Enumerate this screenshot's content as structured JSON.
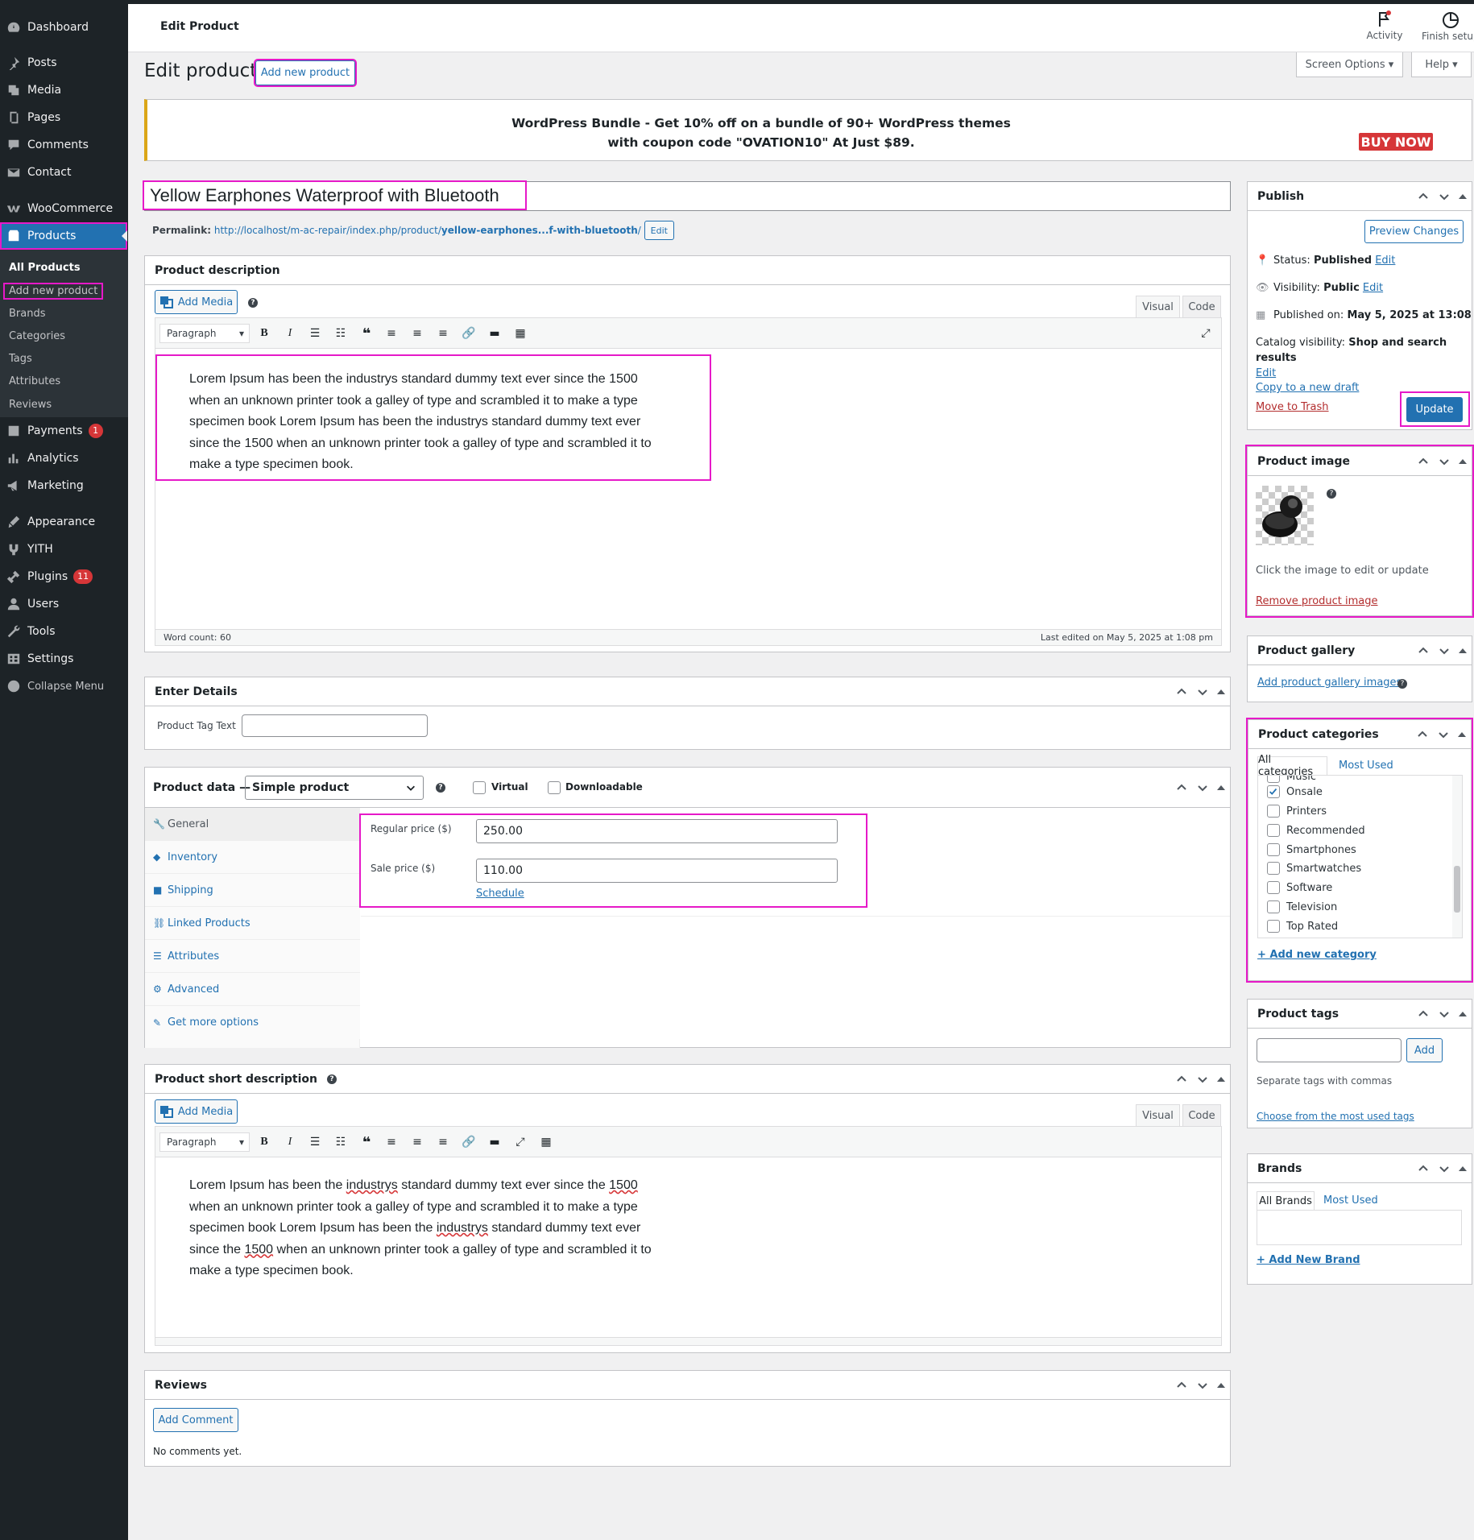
{
  "sidebar": {
    "items": [
      {
        "label": "Dashboard",
        "icon": "dashboard-icon"
      },
      {
        "label": "Posts",
        "icon": "pin-icon"
      },
      {
        "label": "Media",
        "icon": "media-icon"
      },
      {
        "label": "Pages",
        "icon": "pages-icon"
      },
      {
        "label": "Comments",
        "icon": "comments-icon"
      },
      {
        "label": "Contact",
        "icon": "mail-icon"
      },
      {
        "label": "WooCommerce",
        "icon": "woo-icon"
      },
      {
        "label": "Products",
        "icon": "products-icon"
      },
      {
        "label": "Payments",
        "icon": "payments-icon",
        "badge": "1"
      },
      {
        "label": "Analytics",
        "icon": "analytics-icon"
      },
      {
        "label": "Marketing",
        "icon": "marketing-icon"
      },
      {
        "label": "Appearance",
        "icon": "appearance-icon"
      },
      {
        "label": "YITH",
        "icon": "yith-icon"
      },
      {
        "label": "Plugins",
        "icon": "plugins-icon",
        "badge": "11"
      },
      {
        "label": "Users",
        "icon": "users-icon"
      },
      {
        "label": "Tools",
        "icon": "tools-icon"
      },
      {
        "label": "Settings",
        "icon": "settings-icon"
      },
      {
        "label": "Collapse Menu",
        "icon": "collapse-icon"
      }
    ],
    "submenu": [
      "All Products",
      "Add new product",
      "Brands",
      "Categories",
      "Tags",
      "Attributes",
      "Reviews"
    ]
  },
  "header": {
    "title": "Edit Product",
    "activity": "Activity",
    "finish_setup": "Finish setup",
    "screen_options": "Screen Options ▾",
    "help": "Help ▾"
  },
  "page": {
    "heading": "Edit product",
    "add_new": "Add new product"
  },
  "promo": {
    "line1": "WordPress Bundle - Get 10% off on a bundle of 90+ WordPress themes",
    "line2": "with coupon code \"OVATION10\" At Just $89.",
    "buy": "BUY NOW"
  },
  "product": {
    "title": "Yellow Earphones Waterproof with Bluetooth",
    "permalink_label": "Permalink:",
    "permalink_base": "http://localhost/m-ac-repair/index.php/product/",
    "permalink_slug": "yellow-earphones...f-with-bluetooth",
    "permalink_end": "/",
    "permalink_edit": "Edit"
  },
  "description": {
    "title": "Product description",
    "add_media": "Add Media",
    "tab_visual": "Visual",
    "tab_code": "Code",
    "format": "Paragraph",
    "lines": [
      "Lorem Ipsum has been the industrys standard dummy text ever since the 1500",
      "when an unknown printer took a galley of type and scrambled it to make a type",
      "specimen book Lorem Ipsum has been the industrys standard dummy text ever",
      "since the 1500 when an unknown printer took a galley of type and scrambled it to",
      "make a type specimen book."
    ],
    "word_count": "Word count: 60",
    "last_edited": "Last edited on May 5, 2025 at 1:08 pm"
  },
  "details": {
    "title": "Enter Details",
    "tag_label": "Product Tag Text",
    "tag_value": ""
  },
  "product_data": {
    "title": "Product data —",
    "type": "Simple product",
    "virtual": "Virtual",
    "downloadable": "Downloadable",
    "tabs": [
      "General",
      "Inventory",
      "Shipping",
      "Linked Products",
      "Attributes",
      "Advanced",
      "Get more options"
    ],
    "regular_label": "Regular price ($)",
    "regular_value": "250.00",
    "sale_label": "Sale price ($)",
    "sale_value": "110.00",
    "schedule": "Schedule"
  },
  "short_desc": {
    "title": "Product short description",
    "add_media": "Add Media",
    "tab_visual": "Visual",
    "tab_code": "Code",
    "format": "Paragraph"
  },
  "reviews": {
    "title": "Reviews",
    "add_comment": "Add Comment",
    "empty": "No comments yet."
  },
  "publish": {
    "title": "Publish",
    "preview": "Preview Changes",
    "status_label": "Status:",
    "status_value": "Published",
    "visibility_label": "Visibility:",
    "visibility_value": "Public",
    "published_label": "Published on:",
    "published_value": "May 5, 2025 at 13:08",
    "catalog_label": "Catalog visibility:",
    "catalog_value": "Shop and search results",
    "edit": "Edit",
    "copy": "Copy to a new draft",
    "trash": "Move to Trash",
    "update": "Update"
  },
  "image_box": {
    "title": "Product image",
    "hint": "Click the image to edit or update",
    "remove": "Remove product image"
  },
  "gallery": {
    "title": "Product gallery",
    "add": "Add product gallery images"
  },
  "categories": {
    "title": "Product categories",
    "tab_all": "All categories",
    "tab_most": "Most Used",
    "partial": "Music",
    "items": [
      {
        "label": "Onsale",
        "checked": true
      },
      {
        "label": "Printers",
        "checked": false
      },
      {
        "label": "Recommended",
        "checked": false
      },
      {
        "label": "Smartphones",
        "checked": false
      },
      {
        "label": "Smartwatches",
        "checked": false
      },
      {
        "label": "Software",
        "checked": false
      },
      {
        "label": "Television",
        "checked": false
      },
      {
        "label": "Top Rated",
        "checked": false
      }
    ],
    "add": "+ Add new category"
  },
  "tags": {
    "title": "Product tags",
    "add": "Add",
    "hint": "Separate tags with commas",
    "choose": "Choose from the most used tags"
  },
  "brands": {
    "title": "Brands",
    "tab_all": "All Brands",
    "tab_most": "Most Used",
    "add": "+ Add New Brand"
  },
  "colors": {
    "accent": "#2271b1",
    "sidebar": "#1d2327",
    "highlight": "#e619c8",
    "danger": "#d63638"
  }
}
